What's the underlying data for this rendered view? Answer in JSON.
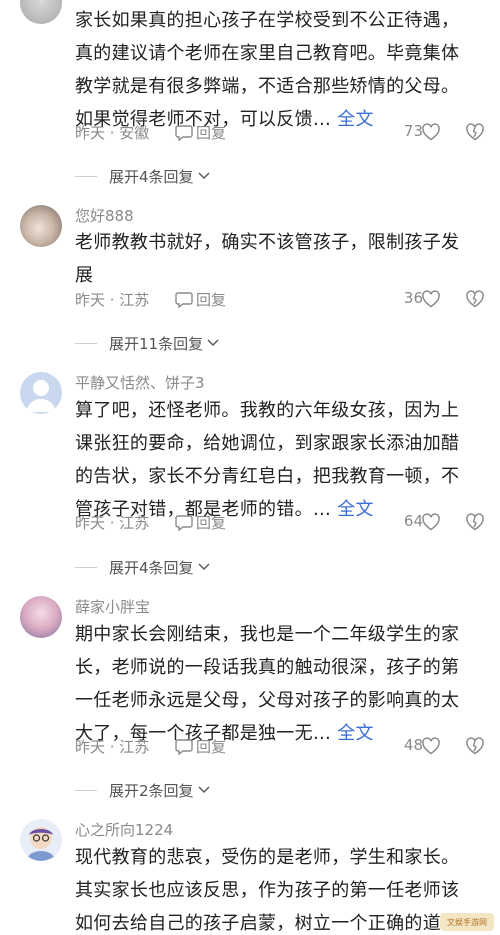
{
  "comments": [
    {
      "username": "",
      "lines": [
        "家长如果真的担心孩子在学校受到不公正待遇，",
        "真的建议请个老师在家里自己教育吧。毕竟集体",
        "教学就是有很多弊端，不适合那些矫情的父母。",
        "如果觉得老师不对，可以反馈…"
      ],
      "full_text_label": "全文",
      "location": "昨天 · 安徽",
      "reply_label": "回复",
      "likes": "73",
      "expand_label": "展开4条回复"
    },
    {
      "username": "您好888",
      "lines": [
        "老师教教书就好，确实不该管孩子，限制孩子发",
        "展"
      ],
      "full_text_label": "",
      "location": "昨天 · 江苏",
      "reply_label": "回复",
      "likes": "36",
      "expand_label": "展开11条回复"
    },
    {
      "username": "平静又恬然、饼子3",
      "lines": [
        "算了吧，还怪老师。我教的六年级女孩，因为上",
        "课张狂的要命，给她调位，到家跟家长添油加醋",
        "的告状，家长不分青红皂白，把我教育一顿，不",
        "管孩子对错，都是老师的错。…"
      ],
      "full_text_label": "全文",
      "location": "昨天 · 江苏",
      "reply_label": "回复",
      "likes": "64",
      "expand_label": "展开4条回复"
    },
    {
      "username": "薛家小胖宝",
      "lines": [
        "期中家长会刚结束，我也是一个二年级学生的家",
        "长，老师说的一段话我真的触动很深，孩子的第",
        "一任老师永远是父母，父母对孩子的影响真的太",
        "大了，每一个孩子都是独一无…"
      ],
      "full_text_label": "全文",
      "location": "昨天 · 江苏",
      "reply_label": "回复",
      "likes": "48",
      "expand_label": "展开2条回复"
    },
    {
      "username": "心之所向1224",
      "lines": [
        "现代教育的悲哀，受伤的是老师，学生和家长。",
        "其实家长也应该反思，作为孩子的第一任老师该",
        "如何去给自己的孩子启蒙，树立一个正确的道德"
      ],
      "full_text_label": "",
      "location": "",
      "reply_label": "",
      "likes": "",
      "expand_label": ""
    }
  ],
  "watermark": "文娱手游网",
  "colors": {
    "link": "#3b6fd8",
    "meta": "#8a8a8a",
    "text": "#222222"
  }
}
